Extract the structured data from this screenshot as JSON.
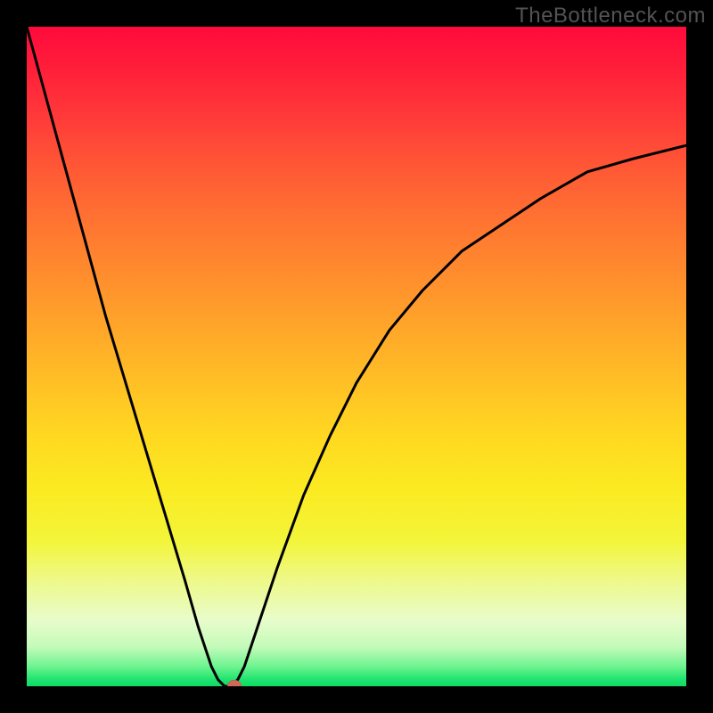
{
  "watermark": "TheBottleneck.com",
  "colors": {
    "frame": "#000000",
    "curve": "#000000",
    "marker": "#cf6a5b"
  },
  "chart_data": {
    "type": "line",
    "title": "",
    "xlabel": "",
    "ylabel": "",
    "xlim": [
      0,
      100
    ],
    "ylim": [
      0,
      100
    ],
    "grid": false,
    "legend": false,
    "annotations": [],
    "series": [
      {
        "name": "bottleneck-curve",
        "x": [
          0,
          3,
          6,
          9,
          12,
          15,
          18,
          21,
          24,
          26,
          28,
          29,
          30,
          31,
          32,
          33,
          35,
          38,
          42,
          46,
          50,
          55,
          60,
          66,
          72,
          78,
          85,
          92,
          100
        ],
        "y": [
          100,
          89,
          78,
          67,
          56,
          46,
          36,
          26,
          16,
          9,
          3,
          1,
          0,
          0,
          1,
          3,
          9,
          18,
          29,
          38,
          46,
          54,
          60,
          66,
          70,
          74,
          78,
          80,
          82
        ]
      }
    ],
    "marker": {
      "x": 31.5,
      "y": 0
    },
    "notes": "Values estimated from pixel inspection; y is V-shaped bottleneck magnitude (0=no bottleneck, 100=max). Minimum around x≈30–32."
  }
}
